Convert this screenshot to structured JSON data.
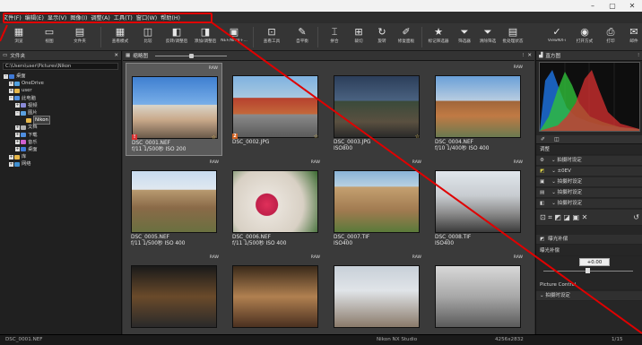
{
  "menubar": {
    "items": [
      "文件(F)",
      "编辑(E)",
      "显示(V)",
      "图像(I)",
      "调整(A)",
      "工具(T)",
      "窗口(W)",
      "帮助(H)"
    ]
  },
  "window_controls": [
    "–",
    "▢",
    "✕"
  ],
  "toolbar": {
    "items": [
      {
        "label": "浏览",
        "icon": "browse-icon"
      },
      {
        "label": "视图",
        "icon": "view-icon"
      },
      {
        "label": "文件夹",
        "icon": "folder-icon"
      },
      {
        "label": "查看模式",
        "icon": "view-mode-icon"
      },
      {
        "label": "比较",
        "icon": "compare-icon"
      },
      {
        "label": "反转/调整后",
        "icon": "toggle-icon"
      },
      {
        "label": "添加/调整后",
        "icon": "add-icon"
      },
      {
        "label": "NEF/NRW+...",
        "icon": "nef-icon"
      },
      {
        "label": "查看工具",
        "icon": "tool-icon"
      },
      {
        "label": "自平衡",
        "icon": "auto-icon"
      },
      {
        "label": "拼合",
        "icon": "merge-icon"
      },
      {
        "label": "裁切",
        "icon": "crop-icon"
      },
      {
        "label": "旋转",
        "icon": "rotate-icon"
      },
      {
        "label": "修复面板",
        "icon": "retouch-icon"
      },
      {
        "label": "标记筛选器",
        "icon": "star-icon"
      },
      {
        "label": "筛选器",
        "icon": "filter-icon"
      },
      {
        "label": "清除筛选",
        "icon": "clear-filter-icon"
      },
      {
        "label": "批处理状态",
        "icon": "batch-icon"
      },
      {
        "label": "ViewNX-i",
        "icon": "viewnx-icon"
      },
      {
        "label": "打开方式",
        "icon": "open-with-icon"
      },
      {
        "label": "打印",
        "icon": "print-icon"
      },
      {
        "label": "邮件",
        "icon": "mail-icon"
      }
    ]
  },
  "left_panel": {
    "title": "文件夹",
    "path": "C:\\Users\\user\\Pictures\\Nikon",
    "tree": [
      {
        "label": "桌面",
        "level": 0,
        "color": "#3f7ad8"
      },
      {
        "label": "OneDrive",
        "level": 1,
        "color": "#4fa0e0"
      },
      {
        "label": "user",
        "level": 1,
        "color": "#e7b84b"
      },
      {
        "label": "此电脑",
        "level": 1,
        "color": "#4f8fe0"
      },
      {
        "label": "视频",
        "level": 2,
        "color": "#8a8ad8"
      },
      {
        "label": "图片",
        "level": 2,
        "color": "#5aa0e0"
      },
      {
        "label": "Nikon",
        "level": 3,
        "color": "#e7b84b"
      },
      {
        "label": "文档",
        "level": 2,
        "color": "#b0b0b0"
      },
      {
        "label": "下载",
        "level": 2,
        "color": "#4f8fe0"
      },
      {
        "label": "音乐",
        "level": 2,
        "color": "#d05fd0"
      },
      {
        "label": "桌面",
        "level": 2,
        "color": "#3f7ad8"
      },
      {
        "label": "库",
        "level": 1,
        "color": "#e7b84b"
      },
      {
        "label": "网络",
        "level": 1,
        "color": "#3f8fd0"
      }
    ]
  },
  "center_panel": {
    "title": "缩略图",
    "thumbnails": [
      {
        "name": "DSC_0001.NEF",
        "info": "f/11 1/500秒 ISO 200",
        "raw": "RAW",
        "star": true,
        "flag": "!",
        "selected": true
      },
      {
        "name": "DSC_0002.JPG",
        "info": "",
        "raw": "",
        "star": true,
        "flag": "2",
        "selected": false
      },
      {
        "name": "DSC_0003.JPG",
        "info": "ISO800",
        "raw": "",
        "star": true,
        "flag": "",
        "selected": false
      },
      {
        "name": "DSC_0004.NEF",
        "info": "f/10 1/400秒 ISO 400",
        "raw": "RAW",
        "star": false,
        "flag": "",
        "selected": false
      },
      {
        "name": "DSC_0005.NEF",
        "info": "f/11 1/500秒 ISO 400",
        "raw": "RAW",
        "star": false,
        "flag": "",
        "selected": false
      },
      {
        "name": "DSC_0006.NEF",
        "info": "f/11 1/500秒 ISO 400",
        "raw": "RAW",
        "star": false,
        "flag": "",
        "selected": false
      },
      {
        "name": "DSC_0007.TIF",
        "info": "ISO400",
        "raw": "RAW",
        "star": false,
        "flag": "",
        "selected": false
      },
      {
        "name": "DSC_0008.TIF",
        "info": "ISO400",
        "raw": "RAW",
        "star": false,
        "flag": "",
        "selected": false
      },
      {
        "name": "",
        "info": "",
        "raw": "RAW",
        "star": false,
        "flag": "",
        "selected": false
      },
      {
        "name": "",
        "info": "",
        "raw": "RAW",
        "star": false,
        "flag": "",
        "selected": false
      },
      {
        "name": "",
        "info": "",
        "raw": "RAW",
        "star": false,
        "flag": "",
        "selected": false
      },
      {
        "name": "",
        "info": "",
        "raw": "RAW",
        "star": false,
        "flag": "",
        "selected": false
      }
    ]
  },
  "right_panel": {
    "title": "直方图",
    "adjust_label": "调整",
    "rows": [
      {
        "label": "拍摄时设定"
      },
      {
        "label": "±0EV"
      },
      {
        "label": "拍摄时设定"
      },
      {
        "label": "拍摄时设定"
      },
      {
        "label": "拍摄时设定"
      }
    ],
    "exposure_title": "曝光补偿",
    "exposure_label": "曝光补偿",
    "exposure_value": "+0.00",
    "picture_control": "Picture Control",
    "picture_control_value": "拍摄时设定"
  },
  "statusbar": {
    "filename": "DSC_0001.NEF",
    "app": "Nikon NX Studio",
    "size": "4256x2832",
    "page": "1/15"
  },
  "colors": {
    "highlight_red": "#e00000",
    "star": "#f0d060",
    "flag_red": "#d83030"
  }
}
